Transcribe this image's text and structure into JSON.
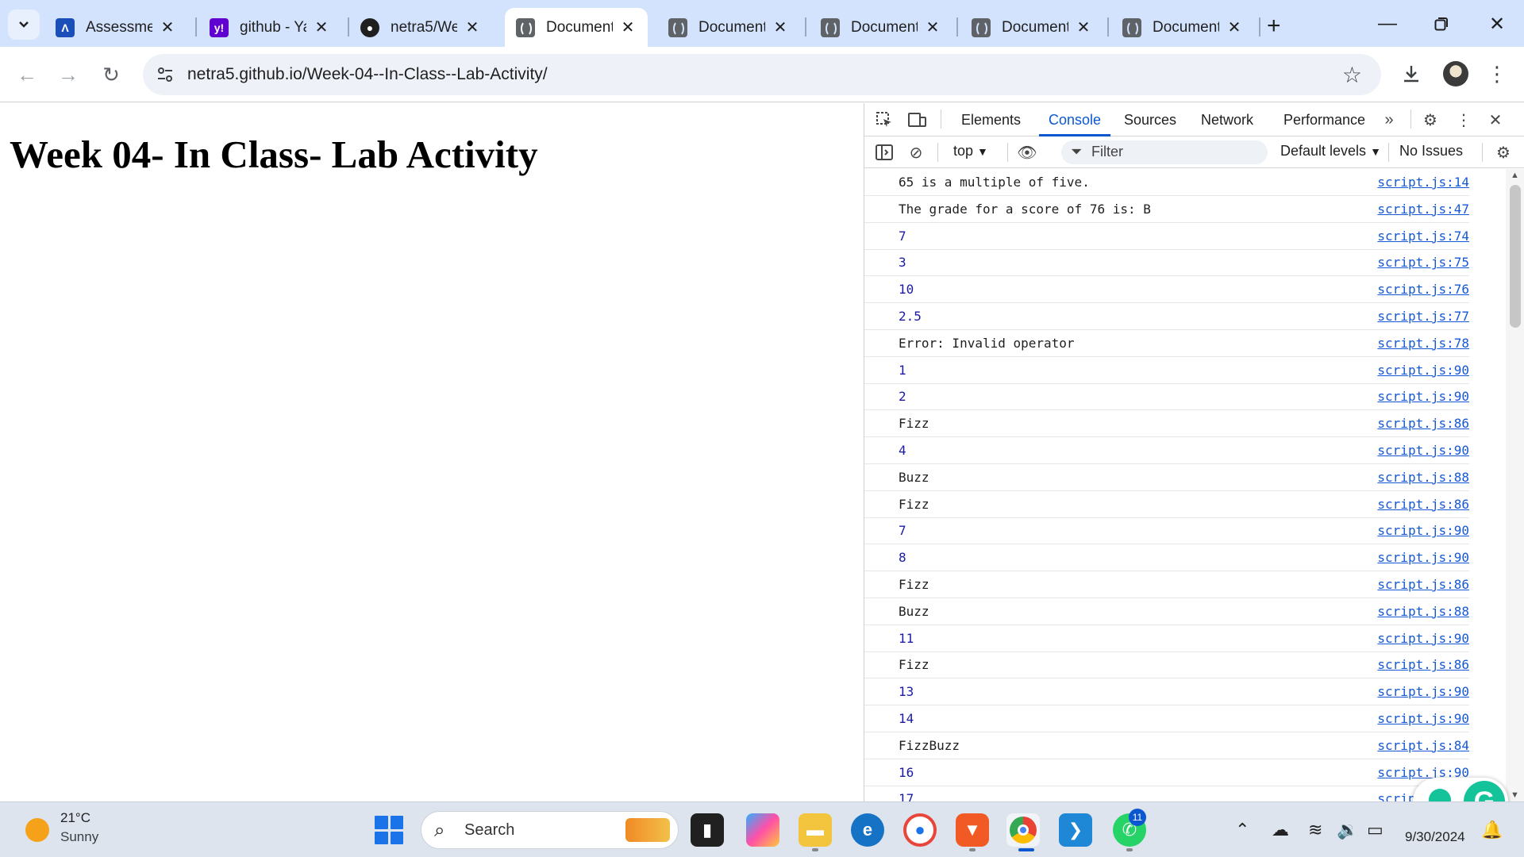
{
  "browser": {
    "tabs": [
      {
        "title": "Assessmen",
        "favicon": "assessment-app-icon",
        "active": false
      },
      {
        "title": "github - Ya",
        "favicon": "yahoo-icon",
        "active": false
      },
      {
        "title": "netra5/We",
        "favicon": "github-icon",
        "active": false
      },
      {
        "title": "Document",
        "favicon": "globe-icon",
        "active": true
      },
      {
        "title": "Document",
        "favicon": "globe-icon",
        "active": false
      },
      {
        "title": "Document",
        "favicon": "globe-icon",
        "active": false
      },
      {
        "title": "Document",
        "favicon": "globe-icon",
        "active": false
      },
      {
        "title": "Document",
        "favicon": "globe-icon",
        "active": false
      }
    ],
    "url": "netra5.github.io/Week-04--In-Class--Lab-Activity/"
  },
  "page": {
    "heading": "Week 04- In Class- Lab Activity"
  },
  "devtools": {
    "tabs": [
      "Elements",
      "Console",
      "Sources",
      "Network",
      "Performance"
    ],
    "active_tab": "Console",
    "context": "top",
    "filter_placeholder": "Filter",
    "levels": "Default levels",
    "issues": "No Issues",
    "console_rows": [
      {
        "msg": "65 is a multiple of five.",
        "src": "script.js:14",
        "kind": "str"
      },
      {
        "msg": "The grade for a score of 76 is: B",
        "src": "script.js:47",
        "kind": "str"
      },
      {
        "msg": "7",
        "src": "script.js:74",
        "kind": "num"
      },
      {
        "msg": "3",
        "src": "script.js:75",
        "kind": "num"
      },
      {
        "msg": "10",
        "src": "script.js:76",
        "kind": "num"
      },
      {
        "msg": "2.5",
        "src": "script.js:77",
        "kind": "num"
      },
      {
        "msg": "Error: Invalid operator",
        "src": "script.js:78",
        "kind": "str"
      },
      {
        "msg": "1",
        "src": "script.js:90",
        "kind": "num"
      },
      {
        "msg": "2",
        "src": "script.js:90",
        "kind": "num"
      },
      {
        "msg": "Fizz",
        "src": "script.js:86",
        "kind": "str"
      },
      {
        "msg": "4",
        "src": "script.js:90",
        "kind": "num"
      },
      {
        "msg": "Buzz",
        "src": "script.js:88",
        "kind": "str"
      },
      {
        "msg": "Fizz",
        "src": "script.js:86",
        "kind": "str"
      },
      {
        "msg": "7",
        "src": "script.js:90",
        "kind": "num"
      },
      {
        "msg": "8",
        "src": "script.js:90",
        "kind": "num"
      },
      {
        "msg": "Fizz",
        "src": "script.js:86",
        "kind": "str"
      },
      {
        "msg": "Buzz",
        "src": "script.js:88",
        "kind": "str"
      },
      {
        "msg": "11",
        "src": "script.js:90",
        "kind": "num"
      },
      {
        "msg": "Fizz",
        "src": "script.js:86",
        "kind": "str"
      },
      {
        "msg": "13",
        "src": "script.js:90",
        "kind": "num"
      },
      {
        "msg": "14",
        "src": "script.js:90",
        "kind": "num"
      },
      {
        "msg": "FizzBuzz",
        "src": "script.js:84",
        "kind": "str"
      },
      {
        "msg": "16",
        "src": "script.js:90",
        "kind": "num"
      },
      {
        "msg": "17",
        "src": "script.js:90",
        "kind": "num"
      }
    ]
  },
  "taskbar": {
    "weather_temp": "21°C",
    "weather_cond": "Sunny",
    "search_label": "Search",
    "whatsapp_badge": "11",
    "time": "",
    "date": "9/30/2024"
  },
  "colors": {
    "accent": "#0b57d0",
    "tabstrip": "#d3e3fd",
    "link": "#1558d6"
  }
}
